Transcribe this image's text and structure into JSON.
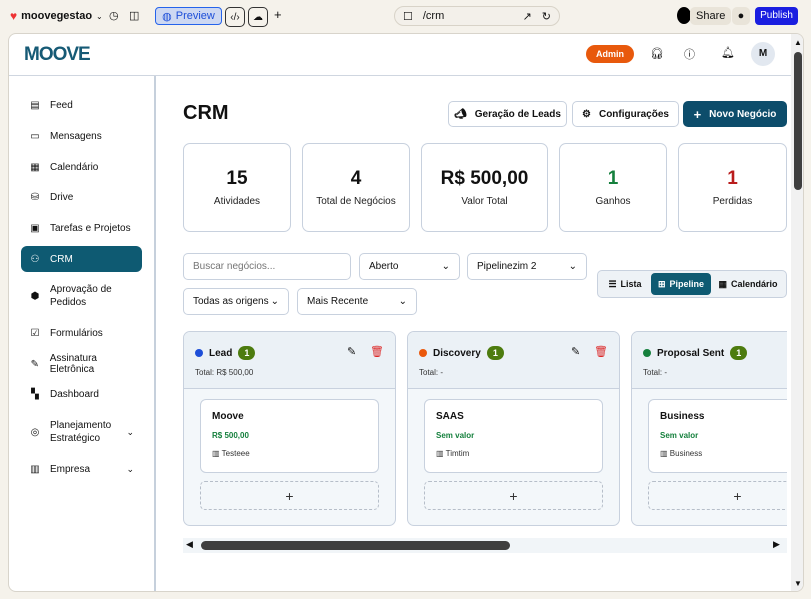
{
  "browser": {
    "project": "moovegestao",
    "preview": "Preview",
    "url": "/crm",
    "share": "Share",
    "publish": "Publish"
  },
  "header": {
    "logo": "MOOVE",
    "admin": "Admin",
    "avatar": "M"
  },
  "sidebar": {
    "items": [
      {
        "label": "Feed",
        "icon": "newspaper-icon"
      },
      {
        "label": "Mensagens",
        "icon": "message-icon"
      },
      {
        "label": "Calendário",
        "icon": "calendar-icon"
      },
      {
        "label": "Drive",
        "icon": "drive-icon"
      },
      {
        "label": "Tarefas e Projetos",
        "icon": "clipboard-icon"
      },
      {
        "label": "CRM",
        "icon": "users-icon",
        "active": true
      },
      {
        "label": "Aprovação de Pedidos",
        "icon": "package-icon"
      },
      {
        "label": "Formulários",
        "icon": "form-icon"
      },
      {
        "label": "Assinatura Eletrônica",
        "icon": "pen-icon"
      },
      {
        "label": "Dashboard",
        "icon": "dashboard-icon"
      },
      {
        "label": "Planejamento Estratégico",
        "icon": "target-icon",
        "expandable": true
      },
      {
        "label": "Empresa",
        "icon": "building-icon",
        "expandable": true
      }
    ]
  },
  "main": {
    "title": "CRM",
    "actions": {
      "leads": "Geração de Leads",
      "config": "Configurações",
      "new": "Novo Negócio"
    },
    "stats": [
      {
        "value": "15",
        "label": "Atividades",
        "color": "#111111"
      },
      {
        "value": "4",
        "label": "Total de Negócios",
        "color": "#111111"
      },
      {
        "value": "R$ 500,00",
        "label": "Valor Total",
        "color": "#111111"
      },
      {
        "value": "1",
        "label": "Ganhos",
        "color": "#15803d"
      },
      {
        "value": "1",
        "label": "Perdidas",
        "color": "#b91c1c"
      }
    ],
    "filters": {
      "search_placeholder": "Buscar negócios...",
      "status": "Aberto",
      "pipeline": "Pipelinezim 2",
      "origin": "Todas as origens",
      "sort": "Mais Recente"
    },
    "views": {
      "list": "Lista",
      "pipeline": "Pipeline",
      "calendar": "Calendário",
      "active": "Pipeline"
    },
    "columns": [
      {
        "name": "Lead",
        "count": "1",
        "total": "Total: R$ 500,00",
        "color": "#1d4ed8",
        "deal": {
          "title": "Moove",
          "value": "R$ 500,00",
          "company": "Testeee"
        }
      },
      {
        "name": "Discovery",
        "count": "1",
        "total": "Total: -",
        "color": "#ea580c",
        "deal": {
          "title": "SAAS",
          "value": "Sem valor",
          "company": "Timtim"
        }
      },
      {
        "name": "Proposal Sent",
        "count": "1",
        "total": "Total: -",
        "color": "#15803d",
        "deal": {
          "title": "Business",
          "value": "Sem valor",
          "company": "Business"
        }
      }
    ]
  },
  "colors": {
    "primary": "#0e5a72",
    "admin": "#e8590c",
    "publish": "#1a1ee0"
  }
}
